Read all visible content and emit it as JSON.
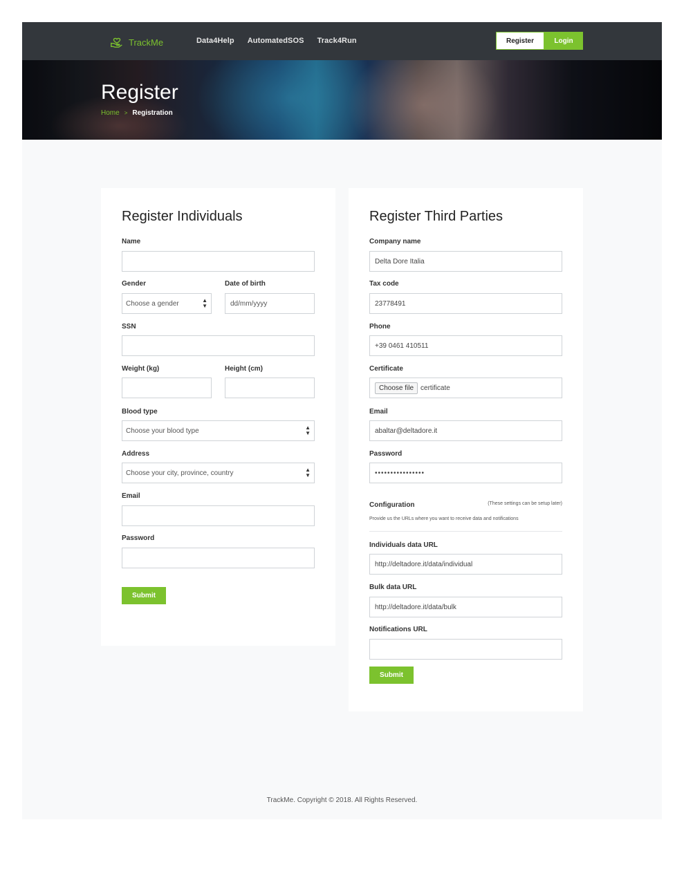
{
  "nav": {
    "brand": "TrackMe",
    "links": [
      "Data4Help",
      "AutomatedSOS",
      "Track4Run"
    ],
    "register_label": "Register",
    "login_label": "Login"
  },
  "hero": {
    "title": "Register",
    "breadcrumb": {
      "home": "Home",
      "separator": ">",
      "current": "Registration"
    }
  },
  "individuals": {
    "title": "Register Individuals",
    "name_label": "Name",
    "name_value": "",
    "gender_label": "Gender",
    "gender_selected": "Choose a gender",
    "dob_label": "Date of birth",
    "dob_placeholder": "dd/mm/yyyy",
    "ssn_label": "SSN",
    "ssn_value": "",
    "weight_label": "Weight (kg)",
    "weight_value": "",
    "height_label": "Height (cm)",
    "height_value": "",
    "blood_label": "Blood type",
    "blood_selected": "Choose your blood type",
    "address_label": "Address",
    "address_selected": "Choose your city, province, country",
    "email_label": "Email",
    "email_value": "",
    "password_label": "Password",
    "password_value": "",
    "submit_label": "Submit"
  },
  "third_parties": {
    "title": "Register Third Parties",
    "company_label": "Company name",
    "company_value": "Delta Dore Italia",
    "tax_label": "Tax code",
    "tax_value": "23778491",
    "phone_label": "Phone",
    "phone_value": "+39 0461 410511",
    "cert_label": "Certificate",
    "cert_button": "Choose file",
    "cert_filename": "certificate",
    "email_label": "Email",
    "email_value": "abaltar@deltadore.it",
    "password_label": "Password",
    "password_value": "••••••••••••••••",
    "config_label": "Configuration",
    "config_note": "(These settings can be setup later)",
    "config_desc": "Provide us the URLs where you want to receive data and notifications",
    "ind_url_label": "Individuals data URL",
    "ind_url_value": "http://deltadore.it/data/individual",
    "bulk_url_label": "Bulk data URL",
    "bulk_url_value": "http://deltadore.it/data/bulk",
    "notif_url_label": "Notifications URL",
    "notif_url_value": "",
    "submit_label": "Submit"
  },
  "footer": {
    "text": "TrackMe. Copyright © 2018. All Rights Reserved."
  },
  "colors": {
    "accent": "#7cc22e",
    "navbar": "#33373c",
    "page_bg": "#f8f9fa"
  }
}
